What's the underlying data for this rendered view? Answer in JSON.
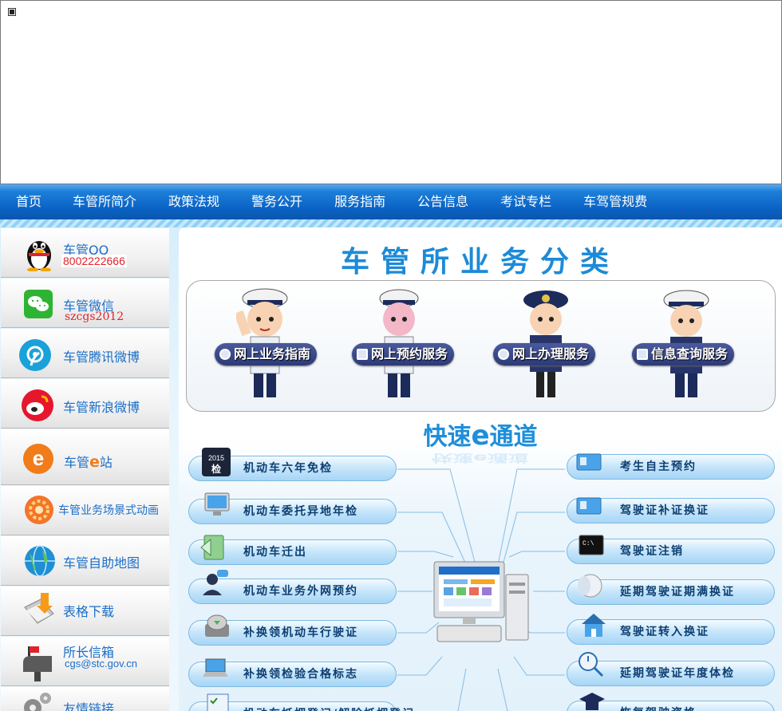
{
  "nav": {
    "items": [
      "首页",
      "车管所简介",
      "政策法规",
      "警务公开",
      "服务指南",
      "公告信息",
      "考试专栏",
      "车驾管规费"
    ]
  },
  "sidebar": {
    "qq": {
      "label": "车管QQ",
      "number": "8002222666"
    },
    "wechat": {
      "label": "车管微信",
      "account": "szcgs2012"
    },
    "tencent_weibo": {
      "label": "车管腾讯微博"
    },
    "sina_weibo": {
      "label": "车管新浪微博"
    },
    "estation": {
      "label_prefix": "车管",
      "label_e": "e",
      "label_suffix": "站"
    },
    "animation": {
      "label": "车管业务场景式动画"
    },
    "map": {
      "label": "车管自助地图"
    },
    "forms": {
      "label": "表格下载"
    },
    "mailbox": {
      "label": "所长信箱",
      "email": "cgs@stc.gov.cn"
    },
    "links": {
      "label": "友情链接"
    }
  },
  "main": {
    "title": "车管所业务分类",
    "services": [
      "网上业务指南",
      "网上预约服务",
      "网上办理服务",
      "信息查询服务"
    ],
    "fast_title_prefix": "快速",
    "fast_title_e": "e",
    "fast_title_suffix": "通道",
    "fast_reflection": "快速e通道",
    "left_buttons": [
      "机动车六年免检",
      "机动车委托异地年检",
      "机动车迁出",
      "机动车业务外网预约",
      "补换领机动车行驶证",
      "补换领检验合格标志",
      "机动车抵押登记/解除抵押登记"
    ],
    "right_buttons": [
      "考生自主预约",
      "驾驶证补证换证",
      "驾驶证注销",
      "延期驾驶证期满换证",
      "驾驶证转入换证",
      "延期驾驶证年度体检",
      "恢复驾驶资格"
    ],
    "badge_2015": "2015",
    "badge_check": "检"
  },
  "colors": {
    "nav_blue": "#0a62c4",
    "title_blue": "#1d8ad8",
    "qq_number_red": "#e0232b",
    "button_text": "#0d3f72"
  }
}
